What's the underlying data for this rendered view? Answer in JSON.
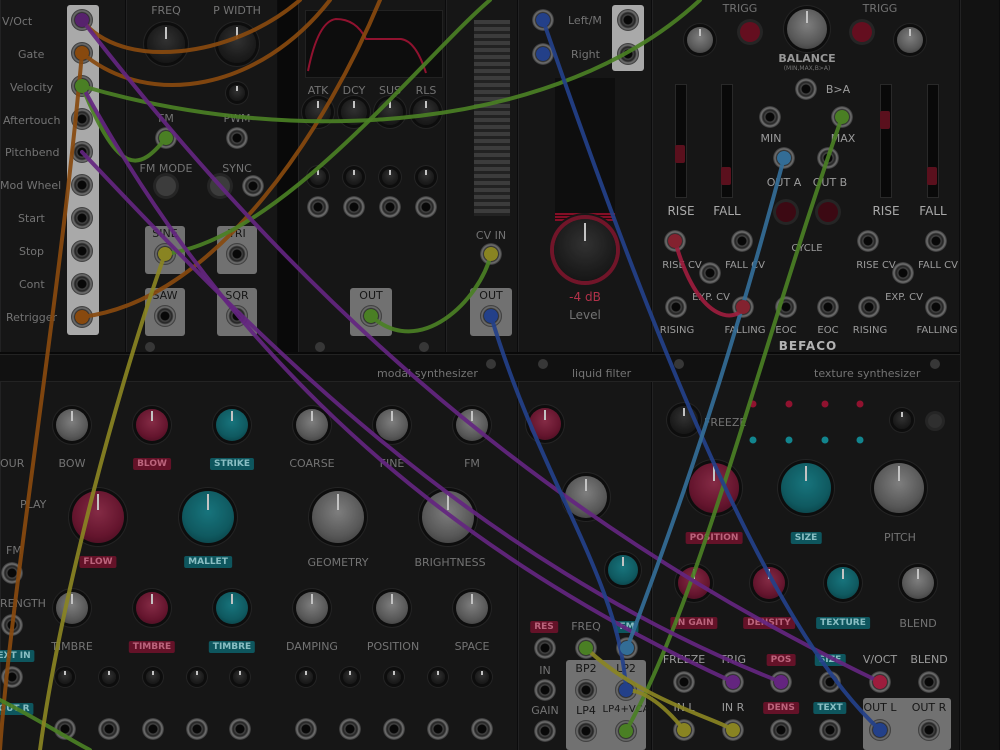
{
  "midi_cv": {
    "rows": [
      "V/Oct",
      "Gate",
      "Velocity",
      "Aftertouch",
      "Pitchbend",
      "Mod Wheel",
      "Start",
      "Stop",
      "Cont",
      "Retrigger"
    ]
  },
  "vco": {
    "freq": "FREQ",
    "pwidth": "P WIDTH",
    "fm": "FM",
    "pwm": "PWM",
    "fm_mode": "FM MODE",
    "sync": "SYNC",
    "sine": "SINE",
    "tri": "TRI",
    "saw": "SAW",
    "sqr": "SQR"
  },
  "adsr": {
    "atk": "ATK",
    "dcy": "DCY",
    "sus": "SUS",
    "rls": "RLS",
    "out": "OUT"
  },
  "scope": {
    "cv_in": "CV IN",
    "out": "OUT"
  },
  "audio": {
    "left": "Left/M",
    "right": "Right",
    "level_value": "-4 dB",
    "level_label": "Level"
  },
  "rampage": {
    "trigg_left": "TRIGG",
    "trigg_right": "TRIGG",
    "balance": "BALANCE",
    "balance_sub": "(MIN,MAX,B>A)",
    "b_gt_a": "B>A",
    "min": "MIN",
    "max": "MAX",
    "out_a": "OUT A",
    "out_b": "OUT B",
    "rise": "RISE",
    "fall": "FALL",
    "rise_cv": "RISE CV",
    "fall_cv": "FALL CV",
    "exp_cv": "EXP. CV",
    "cycle": "CYCLE",
    "rising": "RISING",
    "falling": "FALLING",
    "eoc": "EOC",
    "brand": "BEFACO"
  },
  "headers": {
    "modal": "modal synthesizer",
    "liquid": "liquid filter",
    "texture": "texture synthesizer"
  },
  "elements": {
    "our": "OUR",
    "bow": "BOW",
    "blow": "BLOW",
    "strike": "STRIKE",
    "play": "PLAY",
    "flow": "FLOW",
    "mallet": "MALLET",
    "fm": "FM",
    "strength": "RENGTH",
    "ext_in": "EXT IN",
    "timbre1": "TIMBRE",
    "timbre2": "TIMBRE",
    "timbre3": "TIMBRE",
    "coarse": "COARSE",
    "fine": "FINE",
    "fm2": "FM",
    "geometry": "GEOMETRY",
    "brightness": "BRIGHTNESS",
    "damping": "DAMPING",
    "position": "POSITION",
    "space": "SPACE",
    "out_r": "OUT R"
  },
  "filter": {
    "res": "RES",
    "freq": "FREQ",
    "fm": "FM",
    "in": "IN",
    "gain": "GAIN",
    "bp2": "BP2",
    "lp2": "LP2",
    "lp4": "LP4",
    "lp4vca": "LP4+VCA"
  },
  "clouds": {
    "freeze": "FREEZE",
    "position": "POSITION",
    "size": "SIZE",
    "pitch": "PITCH",
    "in_gain": "IN GAIN",
    "density": "DENSITY",
    "texture": "TEXTURE",
    "blend": "BLEND",
    "j_freeze": "FREEZE",
    "j_trig": "TRIG",
    "j_pos": "POS",
    "j_size": "SIZE",
    "j_voct": "V/OCT",
    "j_blend": "BLEND",
    "in_l": "IN L",
    "in_r": "IN R",
    "dens": "DENS",
    "text": "TEXT",
    "out_l": "OUT L",
    "out_r": "OUT R"
  },
  "colors": {
    "wire_orange": "#a65a12",
    "wire_green": "#5b9c2c",
    "wire_purple": "#7a2e9c",
    "wire_blue": "#2b4fa8",
    "wire_lightblue": "#3f86b8",
    "wire_yellow": "#a8a22a",
    "accent_red": "#c0244b",
    "accent_teal": "#16a3ae"
  }
}
